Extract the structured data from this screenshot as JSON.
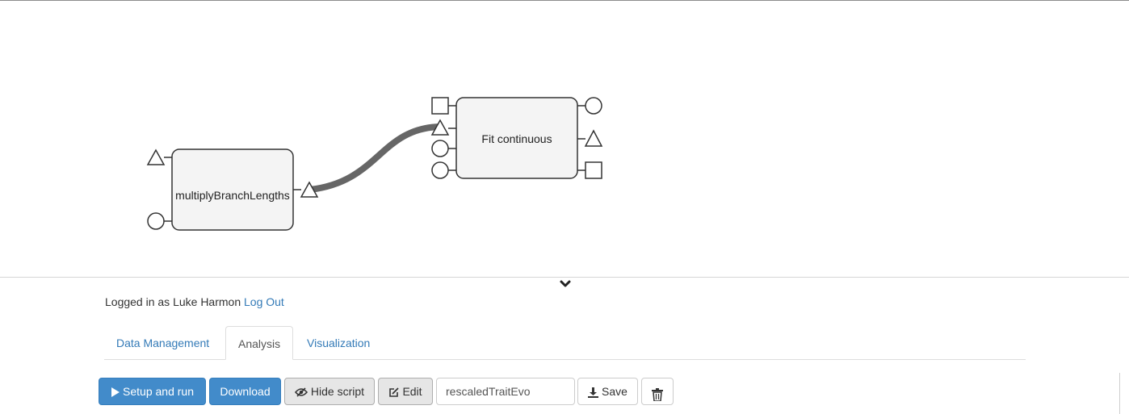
{
  "workflow": {
    "nodes": [
      {
        "id": "multiply",
        "label": "multiplyBranchLengths"
      },
      {
        "id": "fit",
        "label": "Fit continuous"
      }
    ],
    "connections": [
      {
        "from": "multiplyBranchLengths.output-triangle",
        "to": "Fit continuous.input-triangle"
      }
    ]
  },
  "collapse": {
    "icon": "chevron-down-icon"
  },
  "login": {
    "prefix": "Logged in as Luke Harmon",
    "logout_label": "Log Out"
  },
  "tabs": [
    {
      "label": "Data Management",
      "active": false
    },
    {
      "label": "Analysis",
      "active": true
    },
    {
      "label": "Visualization",
      "active": false
    }
  ],
  "toolbar": {
    "setup_run_label": "Setup and run",
    "download_label": "Download",
    "hide_script_label": "Hide script",
    "edit_label": "Edit",
    "script_name_value": "rescaledTraitEvo",
    "save_label": "Save",
    "icons": [
      "play-icon",
      "eye-slash-icon",
      "edit-icon",
      "download-icon",
      "trash-icon"
    ]
  },
  "colors": {
    "primary": "#428bca",
    "link": "#337ab7",
    "node_fill": "#f4f4f4",
    "connection": "#666666"
  }
}
